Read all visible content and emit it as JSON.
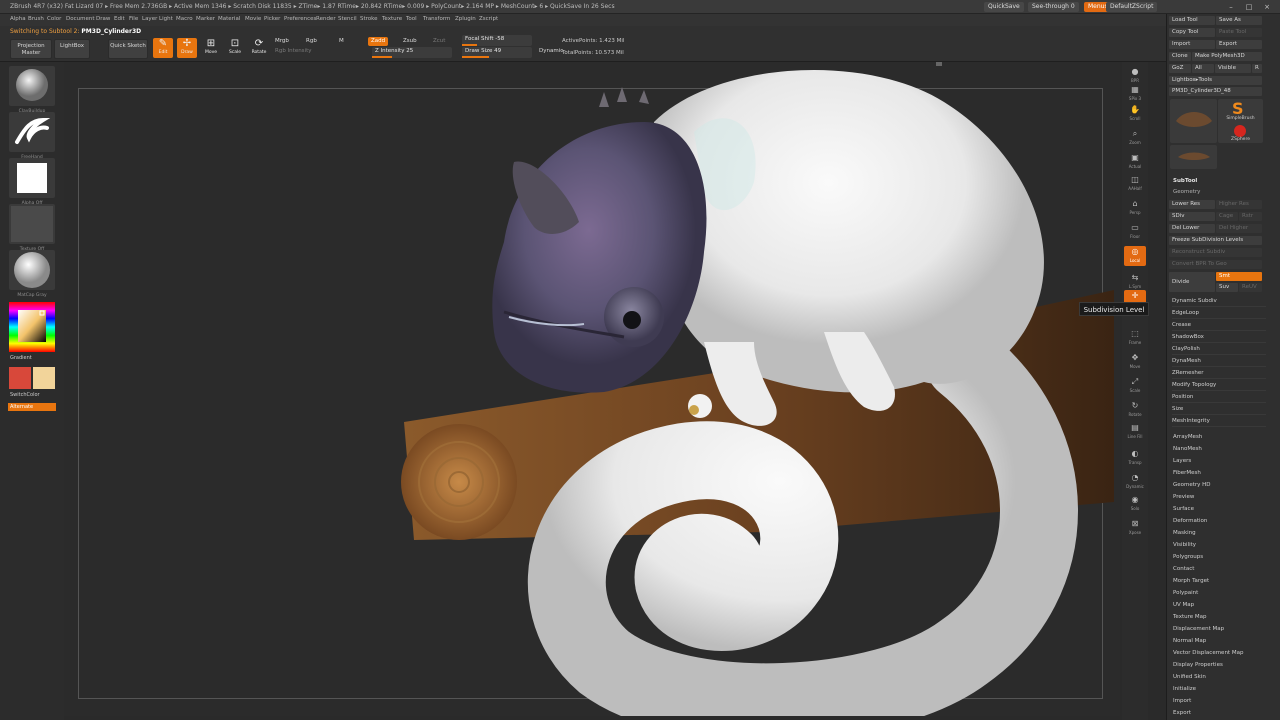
{
  "app": {
    "title": "ZBrush 4R7 (x32)  Fat Lizard 07    ▸ Free Mem 2.736GB ▸ Active Mem 1346 ▸ Scratch Disk 11835 ▸ ZTime▸ 1.87 RTime▸ 20.842 RTime▸ 0.009 ▸ PolyCount▸ 2.164 MP  ▸ MeshCount▸ 6  ▸ QuickSave In 26 Secs",
    "quicksave": "QuickSave",
    "see_through": "See-through  0",
    "menus_btn": "Menus",
    "default_script": "DefaultZScript"
  },
  "menubar": [
    "Alpha",
    "Brush",
    "Color",
    "Document",
    "Draw",
    "Edit",
    "File",
    "Layer",
    "Light",
    "Macro",
    "Marker",
    "Material",
    "Movie",
    "Picker",
    "Preferences",
    "Render",
    "Stencil",
    "Stroke",
    "Texture",
    "Tool",
    "Transform",
    "Zplugin",
    "Zscript"
  ],
  "shelf": {
    "notice_prefix": "Switching to Subtool 2:",
    "notice_name": "PM3D_Cylinder3D",
    "projection_master": "Projection Master",
    "lightbox": "LightBox",
    "quick_sketch": "Quick Sketch",
    "edit": "Edit",
    "draw": "Draw",
    "move": "Move",
    "scale": "Scale",
    "rotate": "Rotate",
    "mrgb": "Mrgb",
    "rgb": "Rgb",
    "m": "M",
    "rgb_intensity": "Rgb Intensity",
    "zadd": "Zadd",
    "zsub": "Zsub",
    "zcut": "Zcut",
    "z_intensity": "Z Intensity 25",
    "z_intensity_value": 25,
    "focal_shift": "Focal Shift -58",
    "focal_shift_value": -58,
    "draw_size": "Draw Size 49",
    "draw_size_value": 49,
    "dynamic": "Dynamic",
    "active_points": "ActivePoints: 1.423  Mil",
    "total_points": "TotalPoints: 10.573  Mil"
  },
  "left_tray": {
    "brush_caption": "ClayBuildup",
    "stroke_caption": "FreeHand",
    "alpha_caption": "Alpha Off",
    "texture_caption": "Texture Off",
    "material_caption": "MatCap Gray",
    "gradient": "Gradient",
    "switch_color": "SwitchColor",
    "alternate": "Alternate",
    "colors": {
      "main": "#d8483a",
      "secondary": "#f2d49a"
    }
  },
  "right_toolbar": [
    {
      "label": "BPR",
      "icon": "sphere-icon"
    },
    {
      "label": "SPix 3",
      "icon": "spix-icon"
    },
    {
      "label": "Scroll",
      "icon": "hand-icon"
    },
    {
      "label": "Zoom",
      "icon": "zoom-icon"
    },
    {
      "label": "Actual",
      "icon": "actual-icon"
    },
    {
      "label": "AAHalf",
      "icon": "aahalf-icon"
    },
    {
      "label": "Persp",
      "icon": "persp-icon"
    },
    {
      "label": "Floor",
      "icon": "floor-icon"
    },
    {
      "label": "Local",
      "icon": "local-icon",
      "active": true
    },
    {
      "label": "L.Sym",
      "icon": "lsym-icon"
    },
    {
      "label": "Gxyz",
      "icon": "xyz-icon",
      "active": true
    },
    {
      "label": "Frame",
      "icon": "frame-icon"
    },
    {
      "label": "Move",
      "icon": "move-icon"
    },
    {
      "label": "Scale",
      "icon": "scale-icon"
    },
    {
      "label": "Rotate",
      "icon": "rotate-icon"
    },
    {
      "label": "Line Fill",
      "icon": "linefill-icon"
    },
    {
      "label": "Transp",
      "icon": "transp-icon"
    },
    {
      "label": "Dynamic",
      "icon": "dynamic-icon"
    },
    {
      "label": "Solo",
      "icon": "solo-icon"
    },
    {
      "label": "Xpose",
      "icon": "xpose-icon"
    }
  ],
  "tooltip": "Subdivision Level",
  "palette": {
    "load_tool": "Load Tool",
    "save_as": "Save As",
    "copy_tool": "Copy Tool",
    "paste_tool": "Paste Tool",
    "import": "Import",
    "export": "Export",
    "clone": "Clone",
    "make_polymesh": "Make PolyMesh3D",
    "goz": "GoZ",
    "all": "All",
    "visible": "Visible",
    "r": "R",
    "lightbox_tools": "Lightbox▸Tools",
    "tool_name": "PM3D_Cylinder3D_48",
    "thumb_captions": [
      "PM3D_Cylinder3D",
      "SimpleBrush",
      "ZSphere",
      "PM3D_Cylinder3D"
    ],
    "subtool": "SubTool",
    "geometry": "Geometry",
    "lower_res": "Lower Res",
    "higher_res": "Higher Res",
    "sdiv": "SDiv",
    "cage": "Cage",
    "rstr": "Rstr",
    "del_lower": "Del Lower",
    "del_higher": "Del Higher",
    "freeze_subdivision": "Freeze SubDivision Levels",
    "reconstruct_subdiv": "Reconstruct Subdiv",
    "convert_bpr": "Convert BPR To Geo",
    "divide": "Divide",
    "smt": "Smt",
    "suv": "Suv",
    "reuv": "ReUV",
    "geometry_items": [
      "Dynamic Subdiv",
      "EdgeLoop",
      "Crease",
      "ShadowBox",
      "ClayPolish",
      "DynaMesh",
      "ZRemesher",
      "Modify Topology",
      "Position",
      "Size",
      "MeshIntegrity"
    ],
    "tool_items": [
      "ArrayMesh",
      "NanoMesh",
      "Layers",
      "FiberMesh",
      "Geometry HD",
      "Preview",
      "Surface",
      "Deformation",
      "Masking",
      "Visibility",
      "Polygroups",
      "Contact",
      "Morph Target",
      "Polypaint",
      "UV Map",
      "Texture Map",
      "Displacement Map",
      "Normal Map",
      "Vector Displacement Map",
      "Display Properties",
      "Unified Skin",
      "Initialize",
      "Import",
      "Export"
    ]
  }
}
